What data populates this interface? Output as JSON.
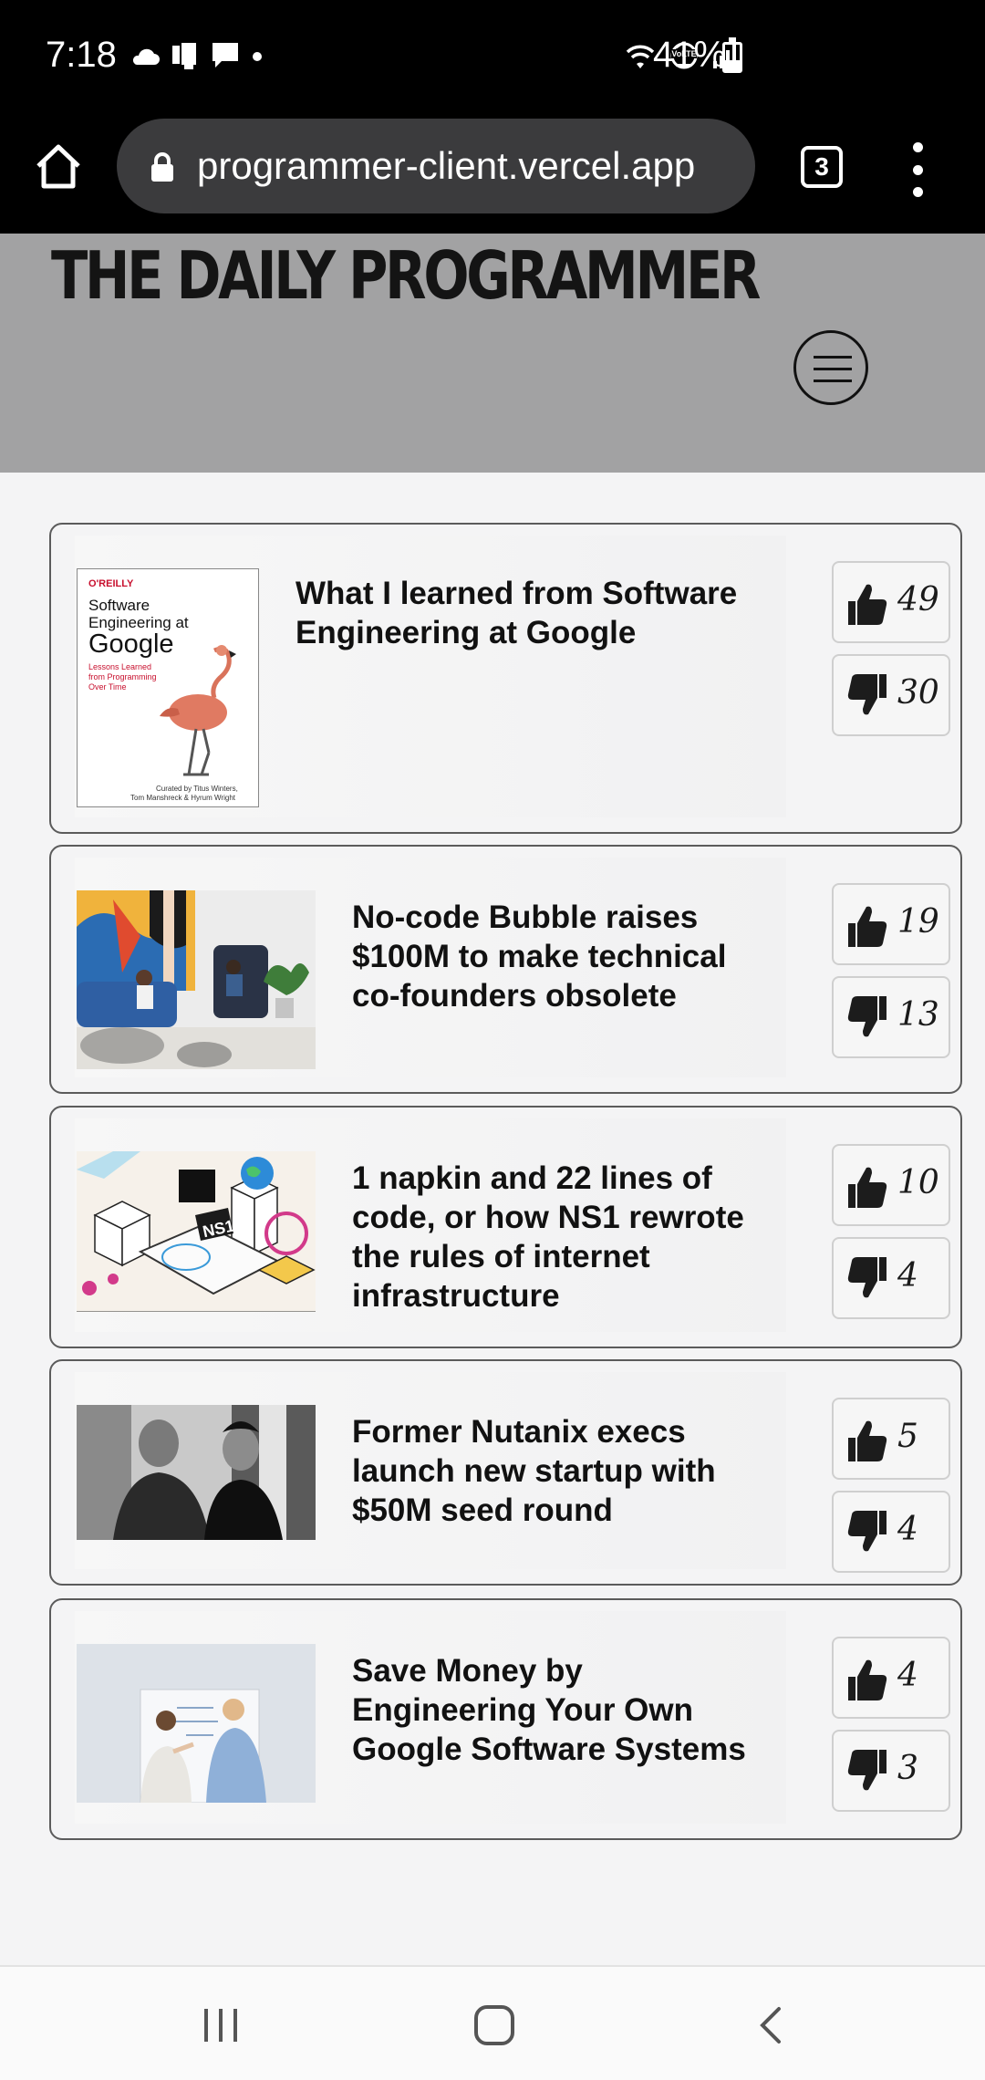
{
  "status_bar": {
    "time": "7:18",
    "battery_percent": "41%",
    "battery_level": 0.41,
    "left_icons": [
      "cloud-icon",
      "notification-icon",
      "message-icon",
      "dot-icon"
    ],
    "right_icons": [
      "wifi-icon",
      "volte-icon",
      "signal-icon",
      "battery-icon"
    ],
    "volte_label": "VoLTE"
  },
  "browser": {
    "url": "programmer-client.vercel.app",
    "tab_count": "3"
  },
  "site": {
    "title": "THE DAILY PROGRAMMER"
  },
  "articles": [
    {
      "title": "What I learned from Software Engineering at Google",
      "likes": "49",
      "dislikes": "30",
      "image": {
        "kind": "book",
        "publisher": "O'REILLY",
        "book_title_line1": "Software",
        "book_title_line2": "Engineering at",
        "book_title_line3": "Google",
        "subtitle_line1": "Lessons Learned",
        "subtitle_line2": "from Programming",
        "subtitle_line3": "Over Time",
        "credit_line1": "Curated by Titus Winters,",
        "credit_line2": "Tom Manshreck & Hyrum Wright"
      }
    },
    {
      "title": "No-code Bubble raises $100M to make technical co-founders obsolete",
      "likes": "19",
      "dislikes": "13",
      "image": {
        "kind": "office-lounge-photo"
      }
    },
    {
      "title": "1 napkin and 22 lines of code, or how NS1 rewrote the rules of internet infrastructure",
      "likes": "10",
      "dislikes": "4",
      "image": {
        "kind": "isometric-illustration",
        "label": "NS1"
      }
    },
    {
      "title": "Former Nutanix execs launch new startup with $50M seed round",
      "likes": "5",
      "dislikes": "4",
      "image": {
        "kind": "portrait-photo-bw"
      }
    },
    {
      "title": "Save Money by Engineering Your Own Google Software Systems",
      "likes": "4",
      "dislikes": "3",
      "image": {
        "kind": "whiteboard-photo"
      }
    }
  ],
  "colors": {
    "header_bg": "#a2a2a3",
    "page_bg": "#f4f4f5",
    "chrome_bg": "#000000",
    "thumb_icon": "#1c1c1c"
  }
}
